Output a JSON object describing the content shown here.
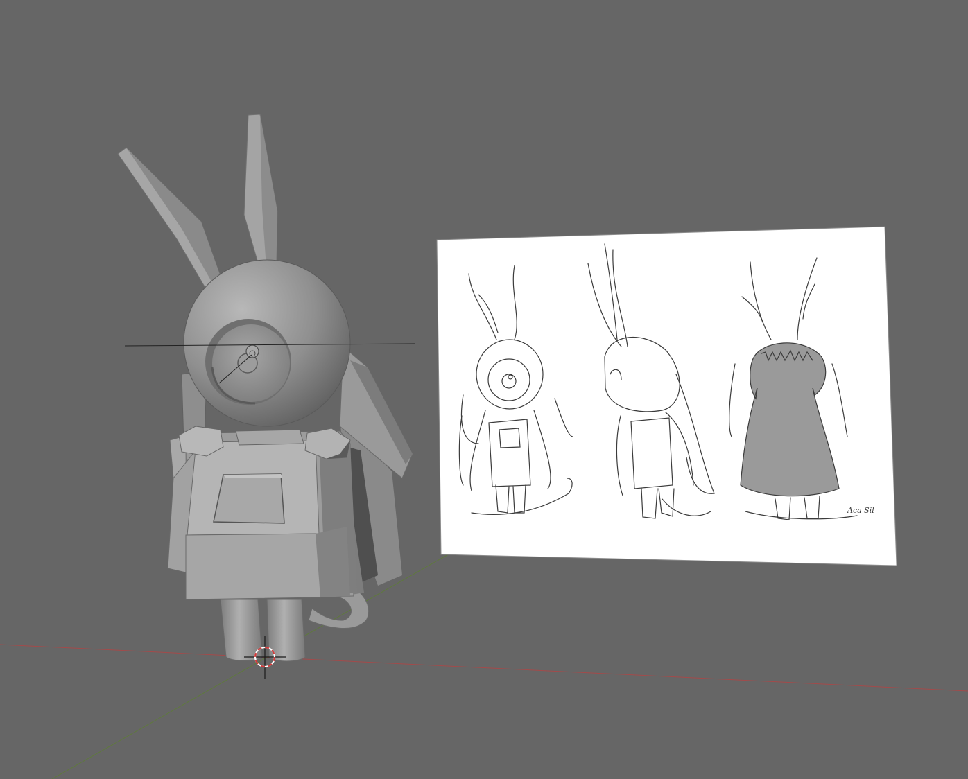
{
  "viewport": {
    "background_color": "#666666",
    "x_axis_color": "#a44a4a",
    "y_axis_color": "#5f7a3c",
    "cursor_ring_colors": [
      "#ffffff",
      "#d13b3b"
    ]
  },
  "model": {
    "base_color": "#9a9a9a",
    "light_color": "#b4b4b4",
    "dark_color": "#6c6c6c",
    "shadow_color": "#4a4a4a"
  },
  "reference_sheet": {
    "paper_color": "#ffffff",
    "ink_color": "#3b3b3b",
    "fill_color": "#9a9a9a",
    "signature": "Aca Sil"
  },
  "icons": {
    "origin": "crosshair-origin-icon",
    "cursor": "3d-cursor-icon"
  }
}
